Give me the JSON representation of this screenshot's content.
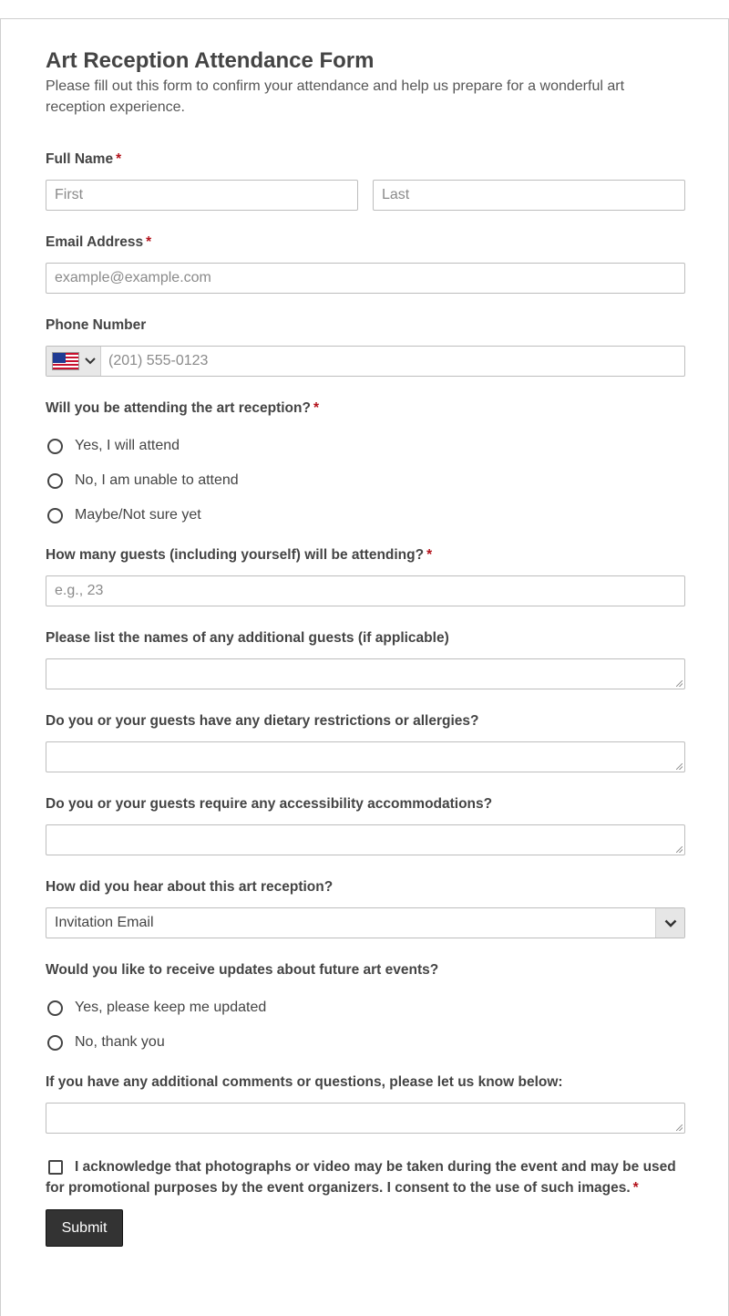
{
  "form": {
    "title": "Art Reception Attendance Form",
    "description": "Please fill out this form to confirm your attendance and help us prepare for a wonderful art reception experience.",
    "required_mark": "*",
    "full_name": {
      "label": "Full Name",
      "first_placeholder": "First",
      "last_placeholder": "Last"
    },
    "email": {
      "label": "Email Address",
      "placeholder": "example@example.com"
    },
    "phone": {
      "label": "Phone Number",
      "country_icon": "us-flag-icon",
      "placeholder": "(201) 555-0123"
    },
    "attending": {
      "label": "Will you be attending the art reception?",
      "options": [
        "Yes, I will attend",
        "No, I am unable to attend",
        "Maybe/Not sure yet"
      ]
    },
    "guest_count": {
      "label": "How many guests (including yourself) will be attending?",
      "placeholder": "e.g., 23"
    },
    "guest_names": {
      "label": "Please list the names of any additional guests (if applicable)"
    },
    "dietary": {
      "label": "Do you or your guests have any dietary restrictions or allergies?"
    },
    "accessibility": {
      "label": "Do you or your guests require any accessibility accommodations?"
    },
    "referral": {
      "label": "How did you hear about this art reception?",
      "selected": "Invitation Email"
    },
    "updates": {
      "label": "Would you like to receive updates about future art events?",
      "options": [
        "Yes, please keep me updated",
        "No, thank you"
      ]
    },
    "comments": {
      "label": "If you have any additional comments or questions, please let us know below:"
    },
    "consent": {
      "text": "I acknowledge that photographs or video may be taken during the event and may be used for promotional purposes by the event organizers. I consent to the use of such images."
    },
    "submit_label": "Submit"
  },
  "colors": {
    "required": "#b3121b",
    "button_bg": "#333333",
    "border": "#bdbdbd"
  }
}
